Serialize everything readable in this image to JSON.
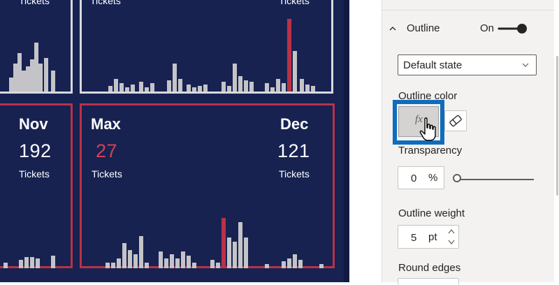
{
  "report": {
    "cards": [
      {
        "id": "top-left",
        "label": "Tickets"
      },
      {
        "id": "top-right",
        "label": "Tickets"
      },
      {
        "id": "nov",
        "month": "Nov",
        "value": "192",
        "label": "Tickets"
      },
      {
        "id": "dec",
        "max_label": "Max",
        "max_value": "27",
        "max_tickets_label": "Tickets",
        "month": "Dec",
        "value": "121",
        "label": "Tickets"
      }
    ],
    "colors": {
      "background": "#172251",
      "bar": "#c4c4c8",
      "highlight_bar": "#b93247",
      "red_outline": "#b93247",
      "white_outline": "#d9d9de",
      "max_value": "#d24253"
    }
  },
  "format_pane": {
    "outline": {
      "title": "Outline",
      "toggle_state": "On",
      "toggle_on": true
    },
    "state_dropdown": {
      "value": "Default state"
    },
    "outline_color": {
      "label": "Outline color",
      "fx_label": "fx",
      "eraser_icon": "eraser-icon"
    },
    "transparency": {
      "label": "Transparency",
      "value": "0",
      "unit": "%",
      "slider_fraction": 0
    },
    "outline_weight": {
      "label": "Outline weight",
      "value": "5",
      "unit": "pt"
    },
    "round_edges": {
      "label": "Round edges"
    },
    "colors": {
      "accent_highlight": "#0f6cbd",
      "toggle": "#252423",
      "pane_bg": "#f3f2f1"
    }
  }
}
